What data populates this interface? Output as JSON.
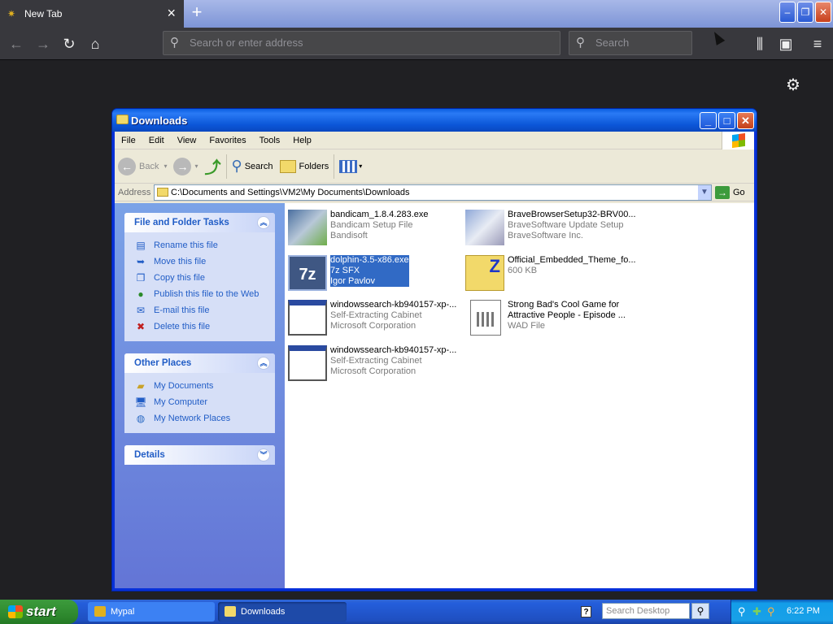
{
  "browser": {
    "tab_title": "New Tab",
    "url_placeholder": "Search or enter address",
    "search_placeholder": "Search"
  },
  "explorer": {
    "title": "Downloads",
    "menu": [
      "File",
      "Edit",
      "View",
      "Favorites",
      "Tools",
      "Help"
    ],
    "toolbar": {
      "back": "Back",
      "search": "Search",
      "folders": "Folders"
    },
    "address_label": "Address",
    "address_path": "C:\\Documents and Settings\\VM2\\My Documents\\Downloads",
    "go_label": "Go",
    "file_tasks": {
      "title": "File and Folder Tasks",
      "items": [
        {
          "label": "Rename this file",
          "icon": "rename-icon"
        },
        {
          "label": "Move this file",
          "icon": "move-icon"
        },
        {
          "label": "Copy this file",
          "icon": "copy-icon"
        },
        {
          "label": "Publish this file to the Web",
          "icon": "web-publish-icon"
        },
        {
          "label": "E-mail this file",
          "icon": "email-icon"
        },
        {
          "label": "Delete this file",
          "icon": "delete-icon"
        }
      ]
    },
    "other_places": {
      "title": "Other Places",
      "items": [
        {
          "label": "My Documents",
          "icon": "folder-icon"
        },
        {
          "label": "My Computer",
          "icon": "computer-icon"
        },
        {
          "label": "My Network Places",
          "icon": "network-icon"
        }
      ]
    },
    "details": {
      "title": "Details"
    },
    "files": [
      {
        "name": "bandicam_1.8.4.283.exe",
        "type": "Bandicam Setup File",
        "meta": "Bandisoft",
        "icon": "installer-icon",
        "selected": false
      },
      {
        "name": "BraveBrowserSetup32-BRV00...",
        "type": "BraveSoftware Update Setup",
        "meta": "BraveSoftware Inc.",
        "icon": "installer-icon",
        "selected": false
      },
      {
        "name": "dolphin-3.5-x86.exe",
        "type": "7z SFX",
        "meta": "Igor Pavlov",
        "icon": "7zip-icon",
        "selected": true
      },
      {
        "name": "Official_Embedded_Theme_fo...",
        "type": "600 KB",
        "meta": "",
        "icon": "zip-folder-icon",
        "selected": false
      },
      {
        "name": "windowssearch-kb940157-xp-...",
        "type": "Self-Extracting Cabinet",
        "meta": "Microsoft Corporation",
        "icon": "window-app-icon",
        "selected": false
      },
      {
        "name": "Strong Bad's Cool Game for",
        "type": "Attractive People - Episode ...",
        "meta": "WAD File",
        "icon": "document-icon",
        "selected": false
      },
      {
        "name": "windowssearch-kb940157-xp-...",
        "type": "Self-Extracting Cabinet",
        "meta": "Microsoft Corporation",
        "icon": "window-app-icon",
        "selected": false
      }
    ]
  },
  "taskbar": {
    "start_label": "start",
    "tasks": [
      {
        "label": "Mypal"
      },
      {
        "label": "Downloads"
      }
    ],
    "desktop_search_placeholder": "Search Desktop",
    "clock": "6:22 PM"
  }
}
